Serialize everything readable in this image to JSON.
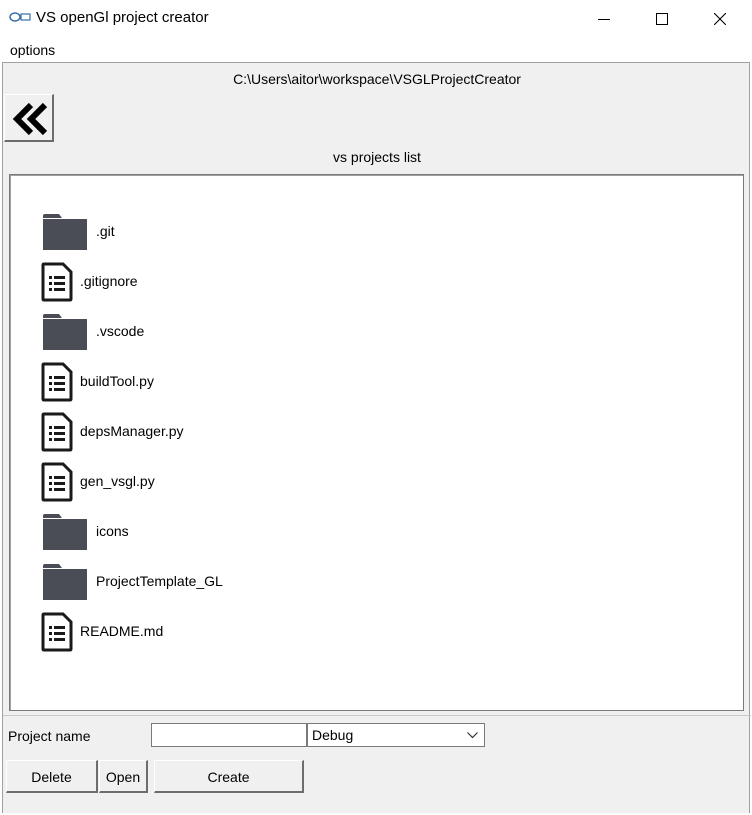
{
  "window": {
    "title": "VS openGl project creator",
    "icon": "vsgl-app-icon"
  },
  "menu": {
    "options_label": "options"
  },
  "path": "C:\\Users\\aitor\\workspace\\VSGLProjectCreator",
  "back_icon": "double-chevron-left-icon",
  "list": {
    "title": "vs projects list",
    "items": [
      {
        "name": ".git",
        "type": "folder"
      },
      {
        "name": ".gitignore",
        "type": "file"
      },
      {
        "name": ".vscode",
        "type": "folder"
      },
      {
        "name": "buildTool.py",
        "type": "file"
      },
      {
        "name": "depsManager.py",
        "type": "file"
      },
      {
        "name": "gen_vsgl.py",
        "type": "file"
      },
      {
        "name": "icons",
        "type": "folder"
      },
      {
        "name": "ProjectTemplate_GL",
        "type": "folder"
      },
      {
        "name": "README.md",
        "type": "file"
      }
    ]
  },
  "form": {
    "project_name_label": "Project name",
    "project_name_value": "",
    "configuration_selected": "Debug"
  },
  "buttons": {
    "delete": "Delete",
    "open": "Open",
    "create": "Create"
  },
  "colors": {
    "folder": "#4a4d55",
    "file_outline": "#1a1a1a",
    "client_bg": "#f0f0f0"
  }
}
